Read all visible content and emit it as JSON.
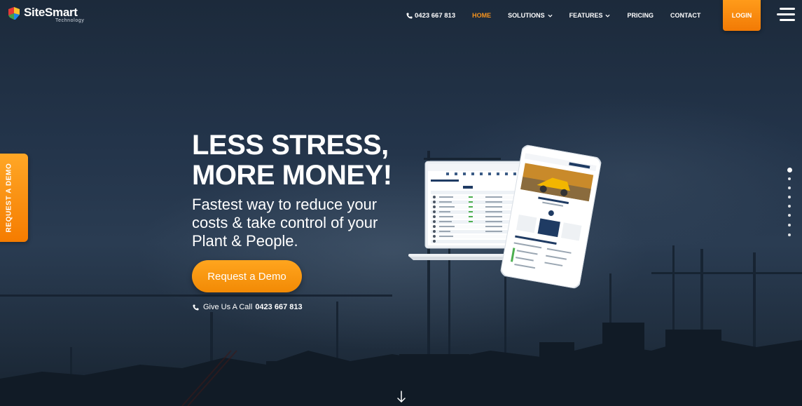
{
  "brand": {
    "name": "SiteSmart",
    "tagline": "Technology"
  },
  "nav": {
    "phone": "0423 667 813",
    "items": [
      {
        "label": "HOME",
        "active": true,
        "dropdown": false
      },
      {
        "label": "SOLUTIONS",
        "active": false,
        "dropdown": true
      },
      {
        "label": "FEATURES",
        "active": false,
        "dropdown": true
      },
      {
        "label": "PRICING",
        "active": false,
        "dropdown": false
      },
      {
        "label": "CONTACT",
        "active": false,
        "dropdown": false
      }
    ],
    "login_label": "LOGIN",
    "menu_icon": "hamburger-menu-icon"
  },
  "side_tab": {
    "label": "REQUEST A DEMO"
  },
  "hero": {
    "title_line1": "LESS STRESS,",
    "title_line2": "MORE MONEY!",
    "subtitle": "Fastest way to reduce your costs & take control of your Plant & People.",
    "cta_label": "Request a Demo",
    "call_prefix": "Give Us A Call",
    "call_number": "0423 667 813"
  },
  "slider": {
    "count": 8,
    "active_index": 0
  },
  "colors": {
    "accent": "#f7941d",
    "background": "#22334a"
  }
}
